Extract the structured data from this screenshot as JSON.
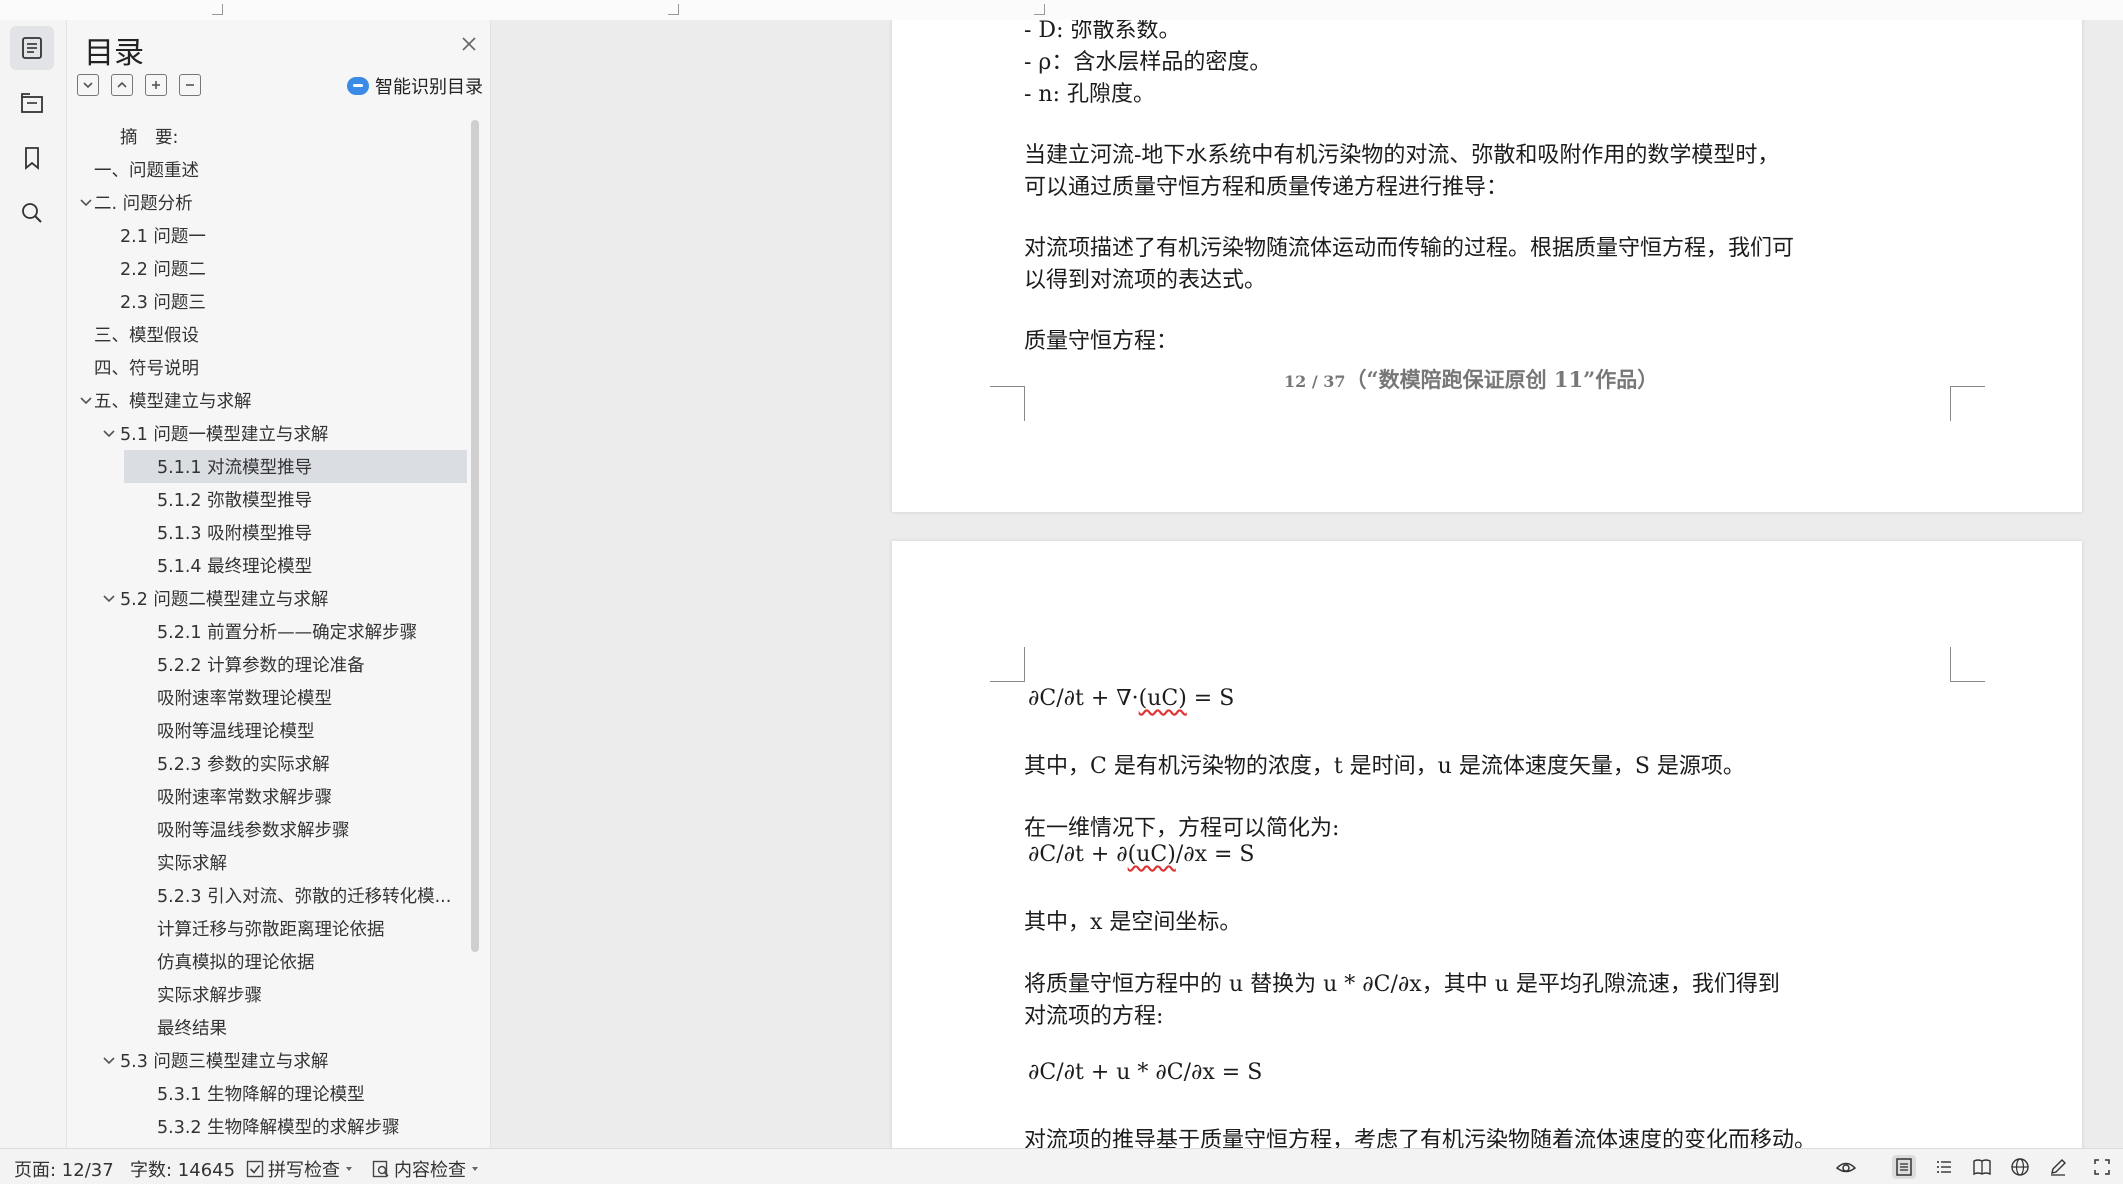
{
  "sidebar": {
    "title": "目录",
    "smart_toc_label": "智能识别目录",
    "items": [
      {
        "label": "摘　要:",
        "level": 1,
        "expanded": null
      },
      {
        "label": "一、问题重述",
        "level": 0,
        "expanded": null
      },
      {
        "label": "二. 问题分析",
        "level": 0,
        "expanded": true
      },
      {
        "label": "2.1 问题一",
        "level": 1,
        "expanded": null
      },
      {
        "label": "2.2 问题二",
        "level": 1,
        "expanded": null
      },
      {
        "label": "2.3 问题三",
        "level": 1,
        "expanded": null
      },
      {
        "label": "三、模型假设",
        "level": 0,
        "expanded": null
      },
      {
        "label": "四、符号说明",
        "level": 0,
        "expanded": null
      },
      {
        "label": "五、模型建立与求解",
        "level": 0,
        "expanded": true
      },
      {
        "label": "5.1 问题一模型建立与求解",
        "level": 1,
        "expanded": true
      },
      {
        "label": "5.1.1  对流模型推导",
        "level": 2,
        "expanded": null,
        "active": true
      },
      {
        "label": "5.1.2  弥散模型推导",
        "level": 2,
        "expanded": null
      },
      {
        "label": "5.1.3  吸附模型推导",
        "level": 2,
        "expanded": null
      },
      {
        "label": "5.1.4  最终理论模型",
        "level": 2,
        "expanded": null
      },
      {
        "label": "5.2 问题二模型建立与求解",
        "level": 1,
        "expanded": true
      },
      {
        "label": "5.2.1  前置分析——确定求解步骤",
        "level": 2,
        "expanded": null
      },
      {
        "label": "5.2.2  计算参数的理论准备",
        "level": 2,
        "expanded": null
      },
      {
        "label": "吸附速率常数理论模型",
        "level": 2,
        "expanded": null
      },
      {
        "label": "吸附等温线理论模型",
        "level": 2,
        "expanded": null
      },
      {
        "label": "5.2.3  参数的实际求解",
        "level": 2,
        "expanded": null
      },
      {
        "label": "吸附速率常数求解步骤",
        "level": 2,
        "expanded": null
      },
      {
        "label": "吸附等温线参数求解步骤",
        "level": 2,
        "expanded": null
      },
      {
        "label": "实际求解",
        "level": 2,
        "expanded": null
      },
      {
        "label": "5.2.3  引入对流、弥散的迁移转化模...",
        "level": 2,
        "expanded": null
      },
      {
        "label": "计算迁移与弥散距离理论依据",
        "level": 2,
        "expanded": null
      },
      {
        "label": "仿真模拟的理论依据",
        "level": 2,
        "expanded": null
      },
      {
        "label": "实际求解步骤",
        "level": 2,
        "expanded": null
      },
      {
        "label": "最终结果",
        "level": 2,
        "expanded": null
      },
      {
        "label": "5.3 问题三模型建立与求解",
        "level": 1,
        "expanded": true
      },
      {
        "label": "5.3.1  生物降解的理论模型",
        "level": 2,
        "expanded": null
      },
      {
        "label": "5.3.2  生物降解模型的求解步骤",
        "level": 2,
        "expanded": null
      }
    ]
  },
  "document": {
    "page1_lines": [
      "- D:  弥散系数。",
      "-   ρ：含水层样品的密度。",
      "- n:  孔隙度。",
      "当建立河流-地下水系统中有机污染物的对流、弥散和吸附作用的数学模型时，",
      "可以通过质量守恒方程和质量传递方程进行推导：",
      "对流项描述了有机污染物随流体运动而传输的过程。根据质量守恒方程，我们可",
      "以得到对流项的表达式。",
      "质量守恒方程："
    ],
    "footer_page": "12 / 37",
    "footer_text": "（“数模陪跑保证原创 11”作品）",
    "eq1_pre": "∂C/∂t +  ∇·",
    "eq1_uc": "(uC)",
    "eq1_post": " = S",
    "page2_lines": [
      "其中，C 是有机污染物的浓度，t 是时间，u 是流体速度矢量，S 是源项。",
      "在一维情况下，方程可以简化为:"
    ],
    "eq2_pre": "∂C/∂t +  ∂",
    "eq2_uc": "(uC)",
    "eq2_post": "/∂x = S",
    "page2_lines_b": [
      "其中，x 是空间坐标。",
      "将质量守恒方程中的 u 替换为 u *   ∂C/∂x，其中 u 是平均孔隙流速，我们得到",
      "对流项的方程:",
      "∂C/∂t + u *   ∂C/∂x = S",
      "对流项的推导基于质量守恒方程，考虑了有机污染物随着流体速度的变化而移动。"
    ]
  },
  "status": {
    "page": "页面: 12/37",
    "words": "字数: 14645",
    "spell_check": "拼写检查",
    "content_check": "内容检查"
  },
  "colors": {
    "accent": "#3a8ae6",
    "active_row": "#dadde2",
    "spell_error": "#d33333"
  }
}
